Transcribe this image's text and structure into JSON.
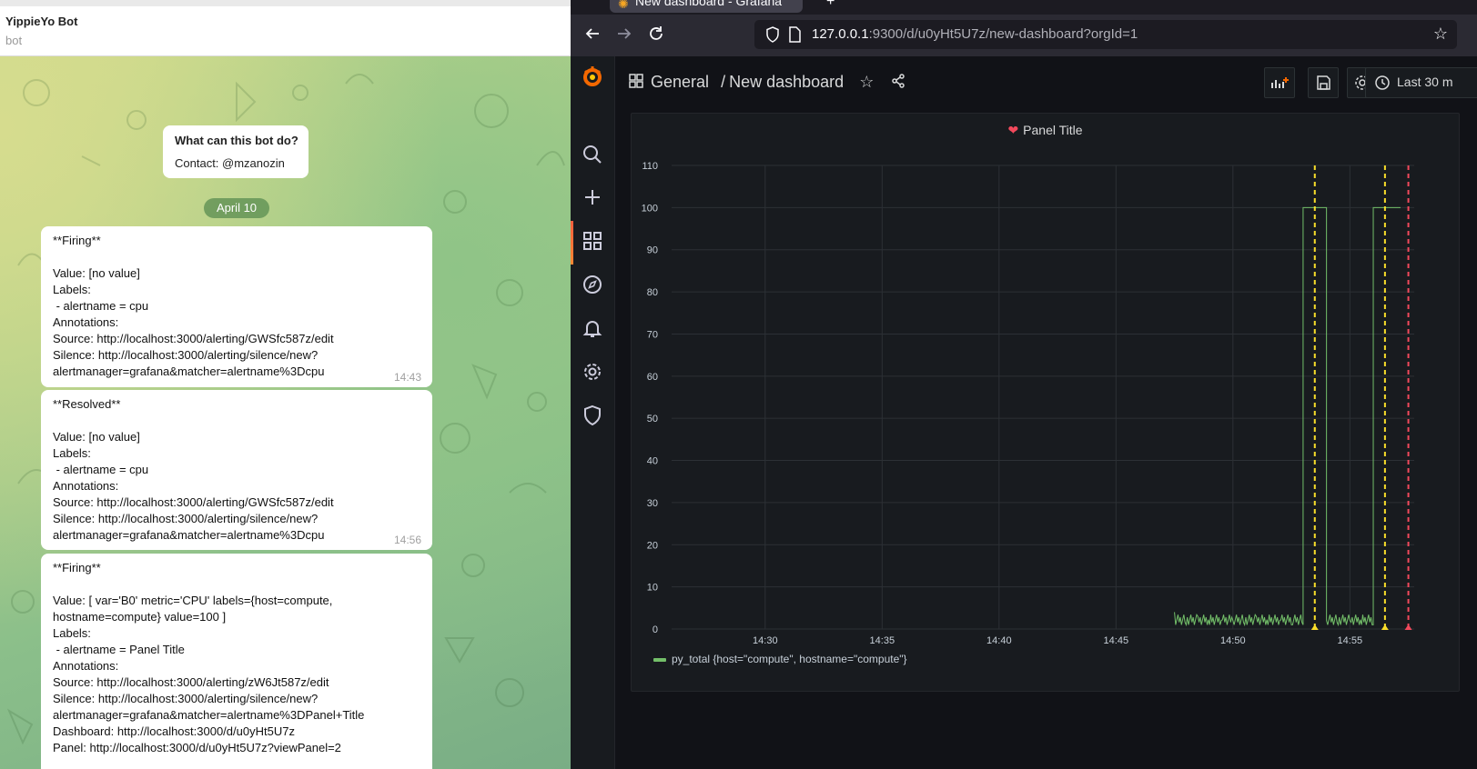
{
  "telegram": {
    "chat_title": "YippieYo Bot",
    "chat_subtitle": "bot",
    "info_title": "What can this bot do?",
    "info_contact": "Contact: @mzanozin",
    "date_badge": "April 10",
    "messages": [
      {
        "text": "**Firing**\n\nValue: [no value]\nLabels:\n - alertname = cpu\nAnnotations:\nSource: http://localhost:3000/alerting/GWSfc587z/edit\nSilence: http://localhost:3000/alerting/silence/new?\nalertmanager=grafana&matcher=alertname%3Dcpu",
        "time": "14:43"
      },
      {
        "text": "**Resolved**\n\nValue: [no value]\nLabels:\n - alertname = cpu\nAnnotations:\nSource: http://localhost:3000/alerting/GWSfc587z/edit\nSilence: http://localhost:3000/alerting/silence/new?\nalertmanager=grafana&matcher=alertname%3Dcpu",
        "time": "14:56"
      },
      {
        "text": "**Firing**\n\nValue: [ var='B0' metric='CPU' labels={host=compute,\nhostname=compute} value=100 ]\nLabels:\n - alertname = Panel Title\nAnnotations:\nSource: http://localhost:3000/alerting/zW6Jt587z/edit\nSilence: http://localhost:3000/alerting/silence/new?\nalertmanager=grafana&matcher=alertname%3DPanel+Title\nDashboard: http://localhost:3000/d/u0yHt5U7z\nPanel: http://localhost:3000/d/u0yHt5U7z?viewPanel=2",
        "time": ""
      }
    ]
  },
  "browser": {
    "tab_title": "New dashboard - Grafana",
    "url_host": "127.0.0.1",
    "url_rest": ":9300/d/u0yHt5U7z/new-dashboard?orgId=1",
    "icons": [
      "back-arrow-icon",
      "forward-arrow-icon",
      "reload-icon",
      "shield-icon",
      "page-icon",
      "bookmark-star-icon"
    ]
  },
  "grafana": {
    "breadcrumb_folder": "General",
    "breadcrumb_sep": "/",
    "breadcrumb_dashboard": "New dashboard",
    "time_range_label": "Last 30 m",
    "nav_icons": [
      "search-icon",
      "plus-icon",
      "dashboards-icon",
      "explore-icon",
      "alerting-bell-icon",
      "configuration-gear-icon",
      "shield-icon"
    ],
    "toolbar_icons": [
      "add-panel-icon",
      "save-icon",
      "settings-icon",
      "clock-icon"
    ],
    "panel_title": "Panel Title",
    "colors": {
      "series": "#73bf69",
      "annotation_alert": "#fade2a",
      "annotation_normal": "#f2495c",
      "brand": "#f46800"
    }
  },
  "chart_data": {
    "type": "line",
    "title": "Panel Title",
    "xlabel": "",
    "ylabel": "",
    "ylim": [
      0,
      110
    ],
    "y_ticks": [
      0,
      10,
      20,
      30,
      40,
      50,
      60,
      70,
      80,
      90,
      100,
      110
    ],
    "x_ticks": [
      "14:30",
      "14:35",
      "14:40",
      "14:45",
      "14:50",
      "14:55"
    ],
    "x_range_minutes": [
      14.53,
      14.59
    ],
    "series": [
      {
        "name": "py_total {host=\"compute\", hostname=\"compute\"}",
        "x": [
          "14:47:30",
          "14:48:00",
          "14:48:30",
          "14:49:00",
          "14:49:30",
          "14:50:00",
          "14:50:30",
          "14:51:00",
          "14:51:30",
          "14:52:00",
          "14:52:30",
          "14:53:00",
          "14:53:00",
          "14:53:30",
          "14:54:00",
          "14:54:00",
          "14:54:30",
          "14:55:00",
          "14:55:30",
          "14:56:00",
          "14:56:00",
          "14:56:30",
          "14:57:00",
          "14:57:10"
        ],
        "values": [
          4,
          1,
          3,
          1,
          2,
          2,
          1,
          3,
          1,
          2,
          1,
          1,
          100,
          100,
          100,
          2,
          1,
          2,
          1,
          1,
          100,
          100,
          100,
          100
        ]
      }
    ],
    "annotations": [
      {
        "time": "14:53:30",
        "color": "yellow"
      },
      {
        "time": "14:56:30",
        "color": "yellow"
      },
      {
        "time": "14:57:30",
        "color": "red"
      }
    ],
    "legend": "bottom-left",
    "grid": true
  }
}
